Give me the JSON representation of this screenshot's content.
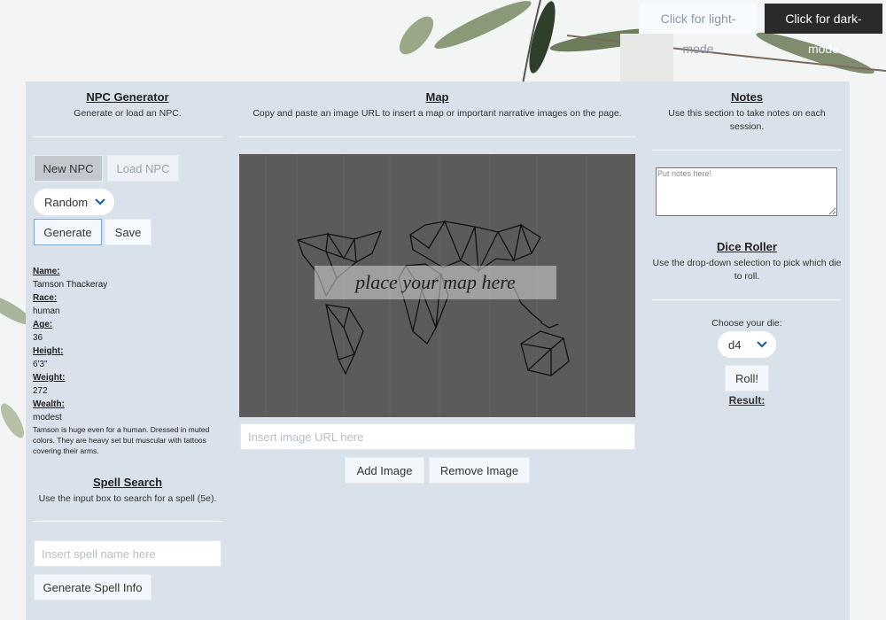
{
  "mode_buttons": {
    "light": "Click for light-mode",
    "dark": "Click for dark-mode"
  },
  "npc": {
    "title": "NPC Generator",
    "desc": "Generate or load an NPC.",
    "new_label": "New NPC",
    "load_label": "Load NPC",
    "type_select": "Random",
    "generate_label": "Generate",
    "save_label": "Save",
    "fields": {
      "name_label": "Name:",
      "name": "Tamson Thackeray",
      "race_label": "Race:",
      "race": "human",
      "age_label": "Age:",
      "age": "36",
      "height_label": "Height:",
      "height": "6'3\"",
      "weight_label": "Weight:",
      "weight": "272",
      "wealth_label": "Wealth:",
      "wealth": "modest",
      "description": "Tamson is huge even for a human. Dressed in muted colors. They are heavy set but muscular with tattoos covering their arms."
    }
  },
  "spell": {
    "title": "Spell Search",
    "desc": "Use the input box to search for a spell (5e).",
    "placeholder": "Insert spell name here",
    "button_label": "Generate Spell Info"
  },
  "map": {
    "title": "Map",
    "desc": "Copy and paste an image URL to insert a map or important narrative images on the page.",
    "caption": "place your map here",
    "url_placeholder": "Insert image URL here",
    "add_label": "Add Image",
    "remove_label": "Remove Image"
  },
  "notes": {
    "title": "Notes",
    "desc": "Use this section to take notes on each session.",
    "placeholder": "Put notes here!"
  },
  "dice": {
    "title": "Dice Roller",
    "desc": "Use the drop-down selection to pick which die to roll.",
    "choose_label": "Choose your die:",
    "die_value": "d4",
    "roll_label": "Roll!",
    "result_label": "Result:"
  },
  "colors": {
    "panel": "#d9e1ea",
    "dark_button": "#2a2a2a",
    "accent": "#1f5fa8"
  }
}
